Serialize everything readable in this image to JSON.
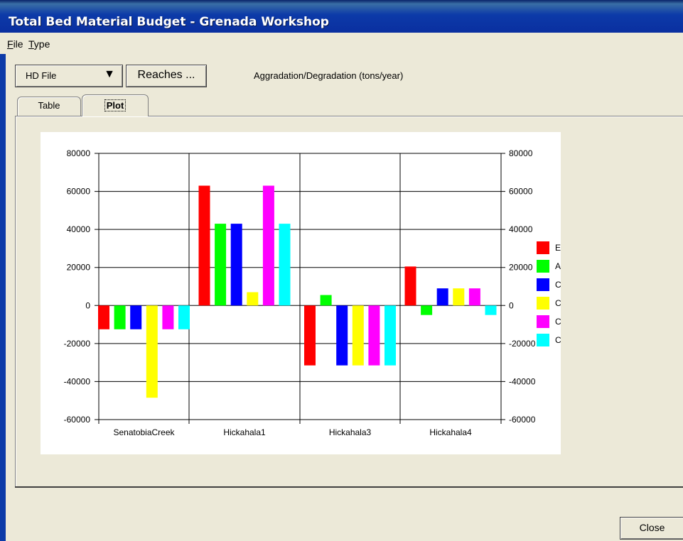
{
  "window": {
    "title": "Total Bed Material Budget - Grenada Workshop"
  },
  "menu": [
    {
      "label": "File"
    },
    {
      "label": "Type"
    }
  ],
  "toolbar": {
    "file_select": {
      "label": "HD File"
    },
    "reaches_label": "Reaches ...",
    "status_text": "Aggradation/Degradation (tons/year)"
  },
  "tabs": [
    {
      "label": "Table",
      "active": false
    },
    {
      "label": "Plot",
      "active": true
    }
  ],
  "footer": {
    "close_label": "Close"
  },
  "colors": {
    "title_bar": "#0a2fa0",
    "window_bg": "#ece9d8"
  },
  "chart_data": {
    "type": "bar",
    "categories": [
      "SenatobiaCreek",
      "Hickahala1",
      "Hickahala3",
      "Hickahala4"
    ],
    "series": [
      {
        "name": "Existing",
        "color": "#ff0000",
        "values": [
          -12500,
          63000,
          -31500,
          20500
        ]
      },
      {
        "name": "All+GCS+Div",
        "color": "#00ff00",
        "values": [
          -12500,
          43000,
          5500,
          -5000
        ]
      },
      {
        "name": "Coarse+Fine",
        "color": "#0000ff",
        "values": [
          -12500,
          43000,
          -31500,
          9000
        ]
      },
      {
        "name": "CB+FB+LT",
        "color": "#ffff00",
        "values": [
          -48500,
          7000,
          -31500,
          9000
        ]
      },
      {
        "name": "Coarse",
        "color": "#ff00ff",
        "values": [
          -12500,
          63000,
          -31500,
          9000
        ]
      },
      {
        "name": "C+F+LT+GC",
        "color": "#00ffff",
        "values": [
          -12500,
          43000,
          -31500,
          -5000
        ]
      }
    ],
    "ylim": [
      -60000,
      80000
    ],
    "yticks": [
      "80000",
      "60000",
      "40000",
      "20000",
      "0",
      "-20000",
      "-40000",
      "-60000"
    ],
    "ytick_values": [
      80000,
      60000,
      40000,
      20000,
      0,
      -20000,
      -40000,
      -60000
    ],
    "grid": "vertical category separators",
    "legend_position": "right"
  }
}
